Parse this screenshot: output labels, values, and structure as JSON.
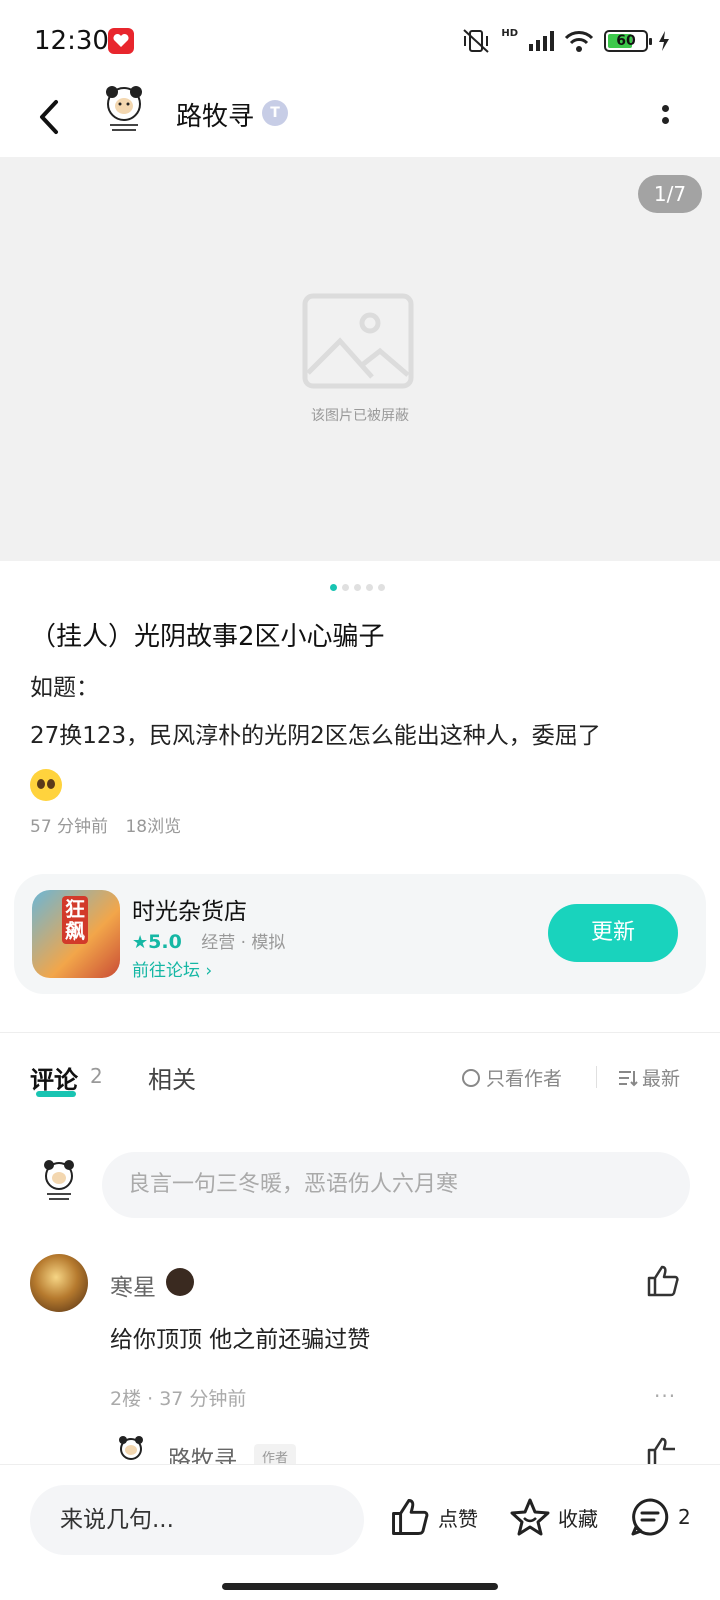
{
  "status_bar": {
    "time": "12:30",
    "network": "HD",
    "battery": "60"
  },
  "header": {
    "author_name": "路牧寻",
    "level_badge": "T"
  },
  "gallery": {
    "counter": "1/7",
    "blocked_text": "该图片已被屏蔽",
    "page_count": 5,
    "active_page": 1
  },
  "post": {
    "title": "（挂人）光阴故事2区小心骗子",
    "line1": "如题：",
    "line2": "27换123，民风淳朴的光阴2区怎么能出这种人，委屈了",
    "time": "57 分钟前",
    "views": "18浏览"
  },
  "app_card": {
    "icon_text": "狂飙",
    "name": "时光杂货店",
    "rating": "5.0",
    "tags": "经营 · 模拟",
    "forum_link": "前往论坛",
    "update_label": "更新"
  },
  "tabs": {
    "comments_label": "评论",
    "comments_count": "2",
    "related_label": "相关",
    "only_author": "只看作者",
    "sort_label": "最新"
  },
  "comment_input": {
    "placeholder": "良言一句三冬暖，恶语伤人六月寒"
  },
  "comments": [
    {
      "user": "寒星",
      "text": "给你顶顶 他之前还骗过赞",
      "meta": "2楼 · 37 分钟前",
      "reply": {
        "user": "路牧寻",
        "tag": "作者"
      }
    }
  ],
  "bottom_bar": {
    "input_placeholder": "来说几句...",
    "like_label": "点赞",
    "fav_label": "收藏",
    "comment_count": "2"
  },
  "colors": {
    "accent": "#19c4b2",
    "update_button": "#19d3bd",
    "notif_app": "#e8262d"
  }
}
